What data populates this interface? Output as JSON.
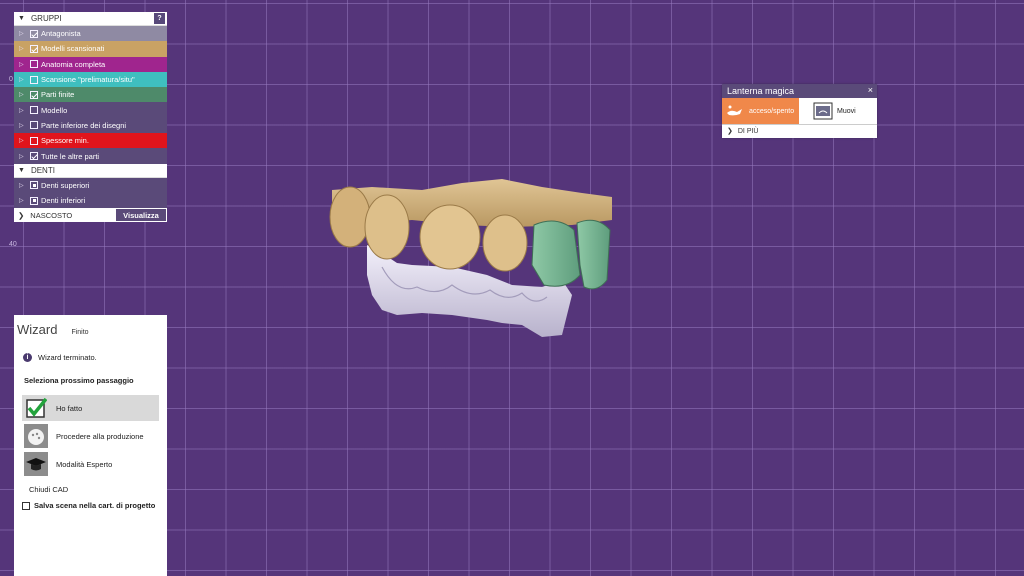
{
  "ruler": {
    "labels": [
      "0",
      "40"
    ]
  },
  "groups_panel": {
    "groups_header": "GRUPPI",
    "help_label": "?",
    "group_items": [
      {
        "label": "Antagonista",
        "checked": true,
        "color": "#8f8aa3"
      },
      {
        "label": "Modelli scansionati",
        "checked": true,
        "color": "#c9a264"
      },
      {
        "label": "Anatomia completa",
        "checked": false,
        "color": "#a0258e"
      },
      {
        "label": "Scansione \"prelimatura/situ\"",
        "checked": false,
        "color": "#3fbfbf"
      },
      {
        "label": "Parti finite",
        "checked": true,
        "color": "#4e8a6a"
      },
      {
        "label": "Modello",
        "checked": false,
        "color": "#5a4a79"
      },
      {
        "label": "Parte inferiore dei disegni",
        "checked": false,
        "color": "#5a4a79"
      },
      {
        "label": "Spessore min.",
        "checked": false,
        "color": "#e0141c"
      },
      {
        "label": "Tutte le altre parti",
        "checked": true,
        "color": "#5a4a79"
      }
    ],
    "teeth_header": "DENTI",
    "teeth_items": [
      {
        "label": "Denti superiori"
      },
      {
        "label": "Denti inferiori"
      }
    ],
    "hidden_label": "NASCOSTO",
    "show_button": "Visualizza"
  },
  "magic_lantern": {
    "title": "Lanterna magica",
    "close": "×",
    "toggle_label": "acceso/spento",
    "move_label": "Muovi",
    "more_label": "DI PIÙ"
  },
  "wizard": {
    "title": "Wizard",
    "state": "Finito",
    "info_icon": "i",
    "message": "Wizard terminato.",
    "next_step_heading": "Seleziona prossimo passaggio",
    "options": [
      {
        "label": "Ho fatto",
        "icon": "checkmark-icon",
        "selected": true
      },
      {
        "label": "Procedere alla produzione",
        "icon": "production-icon",
        "selected": false
      },
      {
        "label": "Modalità Esperto",
        "icon": "graduation-cap-icon",
        "selected": false
      }
    ],
    "close_cad": "Chiudi CAD",
    "save_scene": "Salva scena nella cart. di progetto"
  },
  "colors": {
    "background": "#55357a",
    "grid": "#9678be",
    "panel": "#5a4a79",
    "accent_orange": "#f0884a"
  }
}
